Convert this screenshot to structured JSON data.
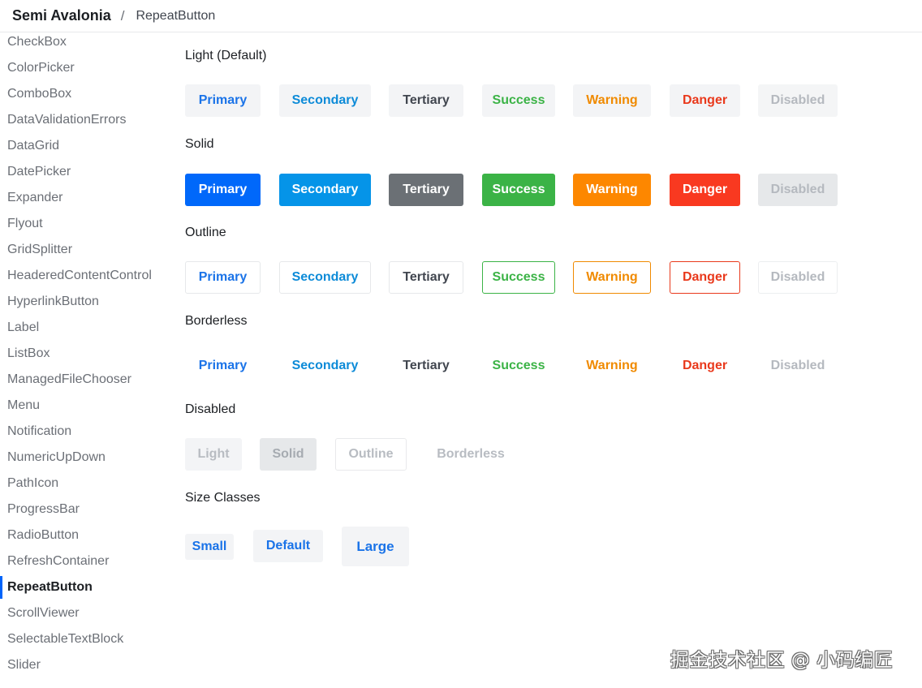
{
  "header": {
    "app_title": "Semi Avalonia",
    "separator": "/",
    "crumb": "RepeatButton"
  },
  "sidebar": {
    "items": [
      {
        "label": "CheckBox"
      },
      {
        "label": "ColorPicker"
      },
      {
        "label": "ComboBox"
      },
      {
        "label": "DataValidationErrors"
      },
      {
        "label": "DataGrid"
      },
      {
        "label": "DatePicker"
      },
      {
        "label": "Expander"
      },
      {
        "label": "Flyout"
      },
      {
        "label": "GridSplitter"
      },
      {
        "label": "HeaderedContentControl"
      },
      {
        "label": "HyperlinkButton"
      },
      {
        "label": "Label"
      },
      {
        "label": "ListBox"
      },
      {
        "label": "ManagedFileChooser"
      },
      {
        "label": "Menu"
      },
      {
        "label": "Notification"
      },
      {
        "label": "NumericUpDown"
      },
      {
        "label": "PathIcon"
      },
      {
        "label": "ProgressBar"
      },
      {
        "label": "RadioButton"
      },
      {
        "label": "RefreshContainer"
      },
      {
        "label": "RepeatButton",
        "active": true
      },
      {
        "label": "ScrollViewer"
      },
      {
        "label": "SelectableTextBlock"
      },
      {
        "label": "Slider"
      }
    ]
  },
  "sections": {
    "light": {
      "title": "Light (Default)",
      "buttons": [
        "Primary",
        "Secondary",
        "Tertiary",
        "Success",
        "Warning",
        "Danger",
        "Disabled"
      ]
    },
    "solid": {
      "title": "Solid",
      "buttons": [
        "Primary",
        "Secondary",
        "Tertiary",
        "Success",
        "Warning",
        "Danger",
        "Disabled"
      ]
    },
    "outline": {
      "title": "Outline",
      "buttons": [
        "Primary",
        "Secondary",
        "Tertiary",
        "Success",
        "Warning",
        "Danger",
        "Disabled"
      ]
    },
    "borderless": {
      "title": "Borderless",
      "buttons": [
        "Primary",
        "Secondary",
        "Tertiary",
        "Success",
        "Warning",
        "Danger",
        "Disabled"
      ]
    },
    "disabled": {
      "title": "Disabled",
      "buttons": [
        "Light",
        "Solid",
        "Outline",
        "Borderless"
      ]
    },
    "sizes": {
      "title": "Size Classes",
      "buttons": [
        "Small",
        "Default",
        "Large"
      ]
    }
  },
  "watermark": "掘金技术社区 @ 小码编匠",
  "colors": {
    "primary": "#0068fa",
    "secondary": "#0594e8",
    "tertiary": "#6b7075",
    "success": "#3bb346",
    "warning": "#fd8700",
    "danger": "#f93920",
    "active_indicator": "#0064fa"
  }
}
